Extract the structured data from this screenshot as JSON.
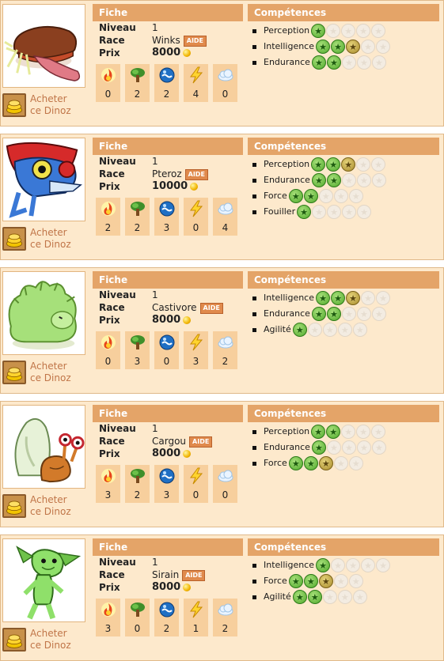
{
  "labels": {
    "fiche": "Fiche",
    "competences": "Compétences",
    "niveau": "Niveau",
    "race": "Race",
    "prix": "Prix",
    "aide": "AIDE",
    "buy_line1": "Acheter",
    "buy_line2": "ce Dinoz"
  },
  "elements": [
    "fire-icon",
    "wood-icon",
    "water-icon",
    "lightning-icon",
    "air-icon"
  ],
  "dinoz": [
    {
      "niveau": "1",
      "race": "Winks",
      "prix": "8000",
      "elements": [
        "0",
        "2",
        "2",
        "4",
        "0"
      ],
      "skills": [
        {
          "name": "Perception",
          "level": 1,
          "tier": [
            "g"
          ]
        },
        {
          "name": "Intelligence",
          "level": 3,
          "tier": [
            "g",
            "g",
            "y"
          ]
        },
        {
          "name": "Endurance",
          "level": 2,
          "tier": [
            "g",
            "g"
          ]
        }
      ]
    },
    {
      "niveau": "1",
      "race": "Pteroz",
      "prix": "10000",
      "elements": [
        "2",
        "2",
        "3",
        "0",
        "4"
      ],
      "skills": [
        {
          "name": "Perception",
          "level": 3,
          "tier": [
            "g",
            "g",
            "y"
          ]
        },
        {
          "name": "Endurance",
          "level": 2,
          "tier": [
            "g",
            "g"
          ]
        },
        {
          "name": "Force",
          "level": 2,
          "tier": [
            "g",
            "g"
          ]
        },
        {
          "name": "Fouiller",
          "level": 1,
          "tier": [
            "g"
          ]
        }
      ]
    },
    {
      "niveau": "1",
      "race": "Castivore",
      "prix": "8000",
      "elements": [
        "0",
        "3",
        "0",
        "3",
        "2"
      ],
      "skills": [
        {
          "name": "Intelligence",
          "level": 3,
          "tier": [
            "g",
            "g",
            "y"
          ]
        },
        {
          "name": "Endurance",
          "level": 2,
          "tier": [
            "g",
            "g"
          ]
        },
        {
          "name": "Agilité",
          "level": 1,
          "tier": [
            "g"
          ]
        }
      ]
    },
    {
      "niveau": "1",
      "race": "Cargou",
      "prix": "8000",
      "elements": [
        "3",
        "2",
        "3",
        "0",
        "0"
      ],
      "skills": [
        {
          "name": "Perception",
          "level": 2,
          "tier": [
            "g",
            "g"
          ]
        },
        {
          "name": "Endurance",
          "level": 1,
          "tier": [
            "g"
          ]
        },
        {
          "name": "Force",
          "level": 3,
          "tier": [
            "g",
            "g",
            "y"
          ]
        }
      ]
    },
    {
      "niveau": "1",
      "race": "Sirain",
      "prix": "8000",
      "elements": [
        "3",
        "0",
        "2",
        "1",
        "2"
      ],
      "skills": [
        {
          "name": "Intelligence",
          "level": 1,
          "tier": [
            "g"
          ]
        },
        {
          "name": "Force",
          "level": 3,
          "tier": [
            "g",
            "g",
            "y"
          ]
        },
        {
          "name": "Agilité",
          "level": 2,
          "tier": [
            "g",
            "g"
          ]
        }
      ]
    }
  ],
  "colors": {
    "card_bg": "#fde9cc",
    "bar": "#e4a468",
    "accent": "#c07548"
  }
}
